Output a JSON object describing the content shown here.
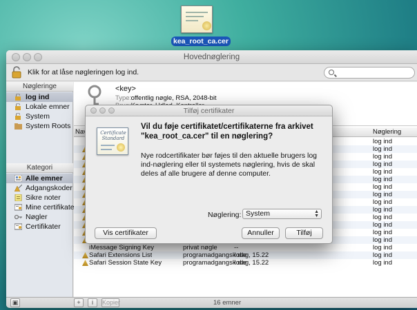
{
  "desktop": {
    "file_name": "kea_root_ca.cer"
  },
  "window": {
    "title": "Hovednøglering",
    "lock_label": "Klik for at låse nøgleringen log ind."
  },
  "sidebar": {
    "keychains_header": "Nøgleringe",
    "keychains": [
      {
        "label": "log ind",
        "icon": "lock-icon",
        "selected": true
      },
      {
        "label": "Lokale emner",
        "icon": "lock-icon",
        "selected": false
      },
      {
        "label": "System",
        "icon": "lock-icon",
        "selected": false
      },
      {
        "label": "System Roots",
        "icon": "folder-icon",
        "selected": false
      }
    ],
    "category_header": "Kategori",
    "categories": [
      {
        "label": "Alle emner",
        "icon": "all-items-icon",
        "selected": true
      },
      {
        "label": "Adgangskoder",
        "icon": "password-icon",
        "selected": false
      },
      {
        "label": "Sikre noter",
        "icon": "note-icon",
        "selected": false
      },
      {
        "label": "Mine certifikater",
        "icon": "certificate-icon",
        "selected": false
      },
      {
        "label": "Nøgler",
        "icon": "key-icon",
        "selected": false
      },
      {
        "label": "Certifikater",
        "icon": "certificate-icon",
        "selected": false
      }
    ]
  },
  "detail": {
    "title": "<key>",
    "type_label": "Type:",
    "type_value": "offentlig nøgle, RSA, 2048-bit",
    "use_label": "Brug:",
    "use_value": "Krypter, Udled, Kontroller"
  },
  "list": {
    "col_name": "Navn",
    "col_keychain": "Nøglering",
    "keychain_value": "log ind",
    "visible_rows": [
      {
        "name": "iMessage Signing Key",
        "kind": "privat nøgle",
        "date": "--",
        "keychain": "log ind"
      },
      {
        "name": "Safari Extensions List",
        "kind": "programadgangskode",
        "date": "I dag, 15.22",
        "keychain": "log ind"
      },
      {
        "name": "Safari Session State Key",
        "kind": "programadgangskode",
        "date": "I dag, 15.22",
        "keychain": "log ind"
      }
    ]
  },
  "statusbar": {
    "copy_label": "Kopier",
    "count": "16 emner"
  },
  "dialog": {
    "title": "Tilføj certifikater",
    "cert_text": "Certificate Standard",
    "question": "Vil du føje certifikatet/certifikaterne fra arkivet \"kea_root_ca.cer\" til en nøglering?",
    "body": "Nye rodcertifikater bør føjes til den aktuelle brugers log ind-nøglering eller til systemets nøglering, hvis de skal deles af alle brugere af denne computer.",
    "keychain_label": "Nøglering:",
    "keychain_value": "System",
    "view_button": "Vis certifikater",
    "cancel_button": "Annuller",
    "add_button": "Tilføj"
  }
}
